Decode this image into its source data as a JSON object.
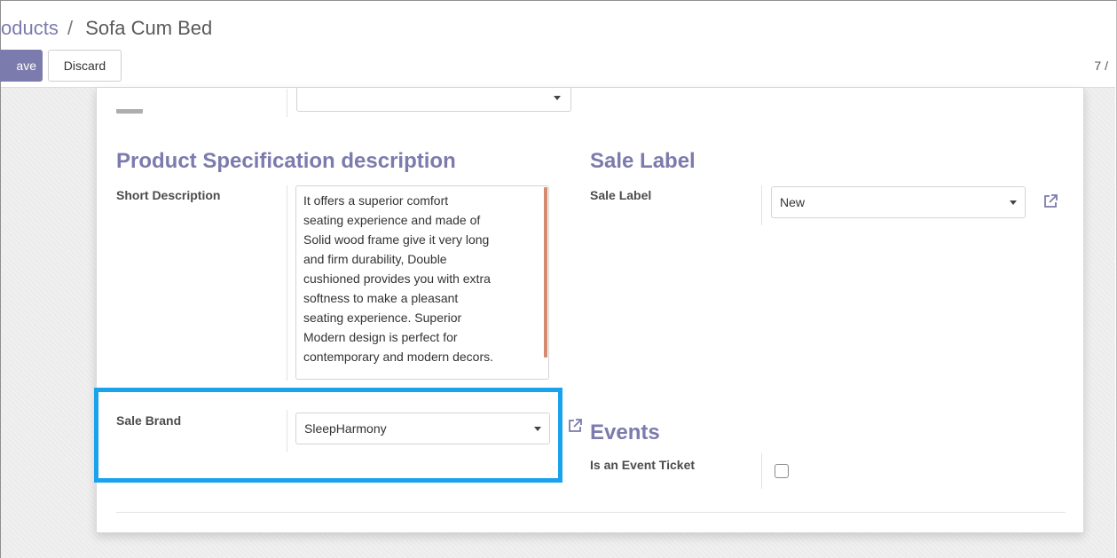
{
  "breadcrumb": {
    "parent": "oducts",
    "separator": "/",
    "current": "Sofa Cum Bed"
  },
  "toolbar": {
    "save_label": "ave",
    "discard_label": "Discard"
  },
  "pager": {
    "text": "7 /"
  },
  "product_spec": {
    "title": "Product Specification description",
    "short_description_label": "Short Description",
    "short_description_lines": [
      "It offers a superior comfort",
      "seating experience and made of",
      "Solid wood frame give it very long",
      "and firm durability, Double",
      "cushioned provides you with extra",
      "softness to make a pleasant",
      "seating experience. Superior",
      "Modern design is perfect for",
      "contemporary and modern decors."
    ],
    "sale_brand_label": "Sale Brand",
    "sale_brand_value": "SleepHarmony"
  },
  "sale_label_section": {
    "title": "Sale Label",
    "field_label": "Sale Label",
    "value": "New"
  },
  "events": {
    "title": "Events",
    "event_ticket_label": "Is an Event Ticket",
    "event_ticket_checked": false
  },
  "colors": {
    "accent": "#7c7bad",
    "highlight": "#1aa3ea",
    "scrollbar": "#d48b70"
  },
  "icons": [
    "caret-down-icon",
    "external-link-icon",
    "checkbox-icon"
  ]
}
